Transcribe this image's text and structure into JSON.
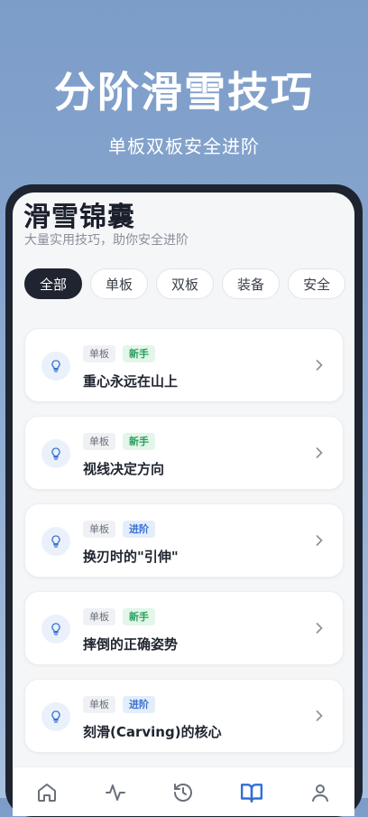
{
  "hero": {
    "title": "分阶滑雪技巧",
    "subtitle": "单板双板安全进阶"
  },
  "page": {
    "title": "滑雪锦囊",
    "subtitle": "大量实用技巧，助你安全进阶"
  },
  "filters": [
    {
      "label": "全部",
      "active": true
    },
    {
      "label": "单板",
      "active": false
    },
    {
      "label": "双板",
      "active": false
    },
    {
      "label": "装备",
      "active": false
    },
    {
      "label": "安全",
      "active": false
    }
  ],
  "tips": [
    {
      "category": "单板",
      "level": "新手",
      "title": "重心永远在山上"
    },
    {
      "category": "单板",
      "level": "新手",
      "title": "视线决定方向"
    },
    {
      "category": "单板",
      "level": "进阶",
      "title": "换刃时的\"引伸\""
    },
    {
      "category": "单板",
      "level": "新手",
      "title": "摔倒的正确姿势"
    },
    {
      "category": "单板",
      "level": "进阶",
      "title": "刻滑(Carving)的核心"
    }
  ],
  "tabbar": [
    {
      "icon": "home-icon",
      "active": false
    },
    {
      "icon": "activity-icon",
      "active": false
    },
    {
      "icon": "history-icon",
      "active": false
    },
    {
      "icon": "book-icon",
      "active": true
    },
    {
      "icon": "user-icon",
      "active": false
    }
  ],
  "colors": {
    "accent": "#2f6fd6",
    "new_tag": "#2a9d5c",
    "advanced_tag": "#3a72d0",
    "active_chip": "#1f2430"
  }
}
